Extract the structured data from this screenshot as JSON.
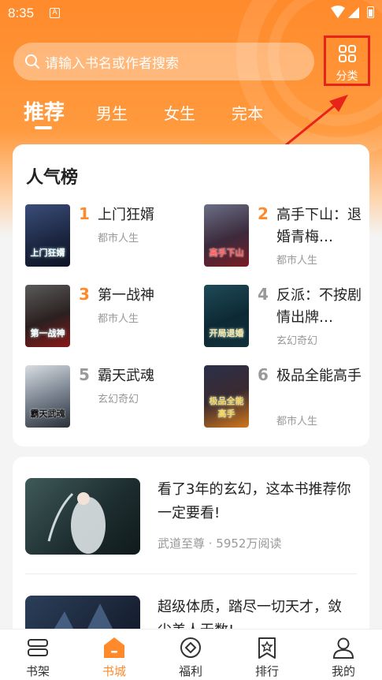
{
  "status_bar": {
    "time": "8:35",
    "notif_letter": "A"
  },
  "search": {
    "placeholder": "请输入书名或作者搜索"
  },
  "category_button": {
    "label": "分类"
  },
  "tabs": [
    {
      "label": "推荐",
      "active": true
    },
    {
      "label": "男生"
    },
    {
      "label": "女生"
    },
    {
      "label": "完本"
    }
  ],
  "popular": {
    "title": "人气榜",
    "books": [
      {
        "rank": "1",
        "name": "上门狂婿",
        "category": "都市人生",
        "cover_text": "上门狂婿"
      },
      {
        "rank": "2",
        "name": "高手下山：退婚青梅…",
        "category": "都市人生",
        "cover_text": "高手下山"
      },
      {
        "rank": "3",
        "name": "第一战神",
        "category": "都市人生",
        "cover_text": "第一战神"
      },
      {
        "rank": "4",
        "name": "反派：不按剧情出牌…",
        "category": "玄幻奇幻",
        "cover_text": "开局退婚"
      },
      {
        "rank": "5",
        "name": "霸天武魂",
        "category": "玄幻奇幻",
        "cover_text": "霸天武魂"
      },
      {
        "rank": "6",
        "name": "极品全能高手",
        "category": "都市人生",
        "cover_text": "极品全能高手"
      }
    ]
  },
  "feed": [
    {
      "title": "看了3年的玄幻，这本书推荐你一定要看!",
      "meta": "武道至尊 · 5952万阅读"
    },
    {
      "title": "超级体质，踏尽一切天才，敛尘美人无数!",
      "meta": ""
    }
  ],
  "bottom_nav": [
    {
      "label": "书架",
      "icon": "bookshelf-icon"
    },
    {
      "label": "书城",
      "icon": "bookstore-icon",
      "active": true
    },
    {
      "label": "福利",
      "icon": "welfare-icon"
    },
    {
      "label": "排行",
      "icon": "ranking-icon"
    },
    {
      "label": "我的",
      "icon": "profile-icon"
    }
  ],
  "colors": {
    "accent": "#ff8a2b",
    "highlight": "#e8231a",
    "rank_top": "#ff8a2b",
    "rank_other": "#999999"
  }
}
